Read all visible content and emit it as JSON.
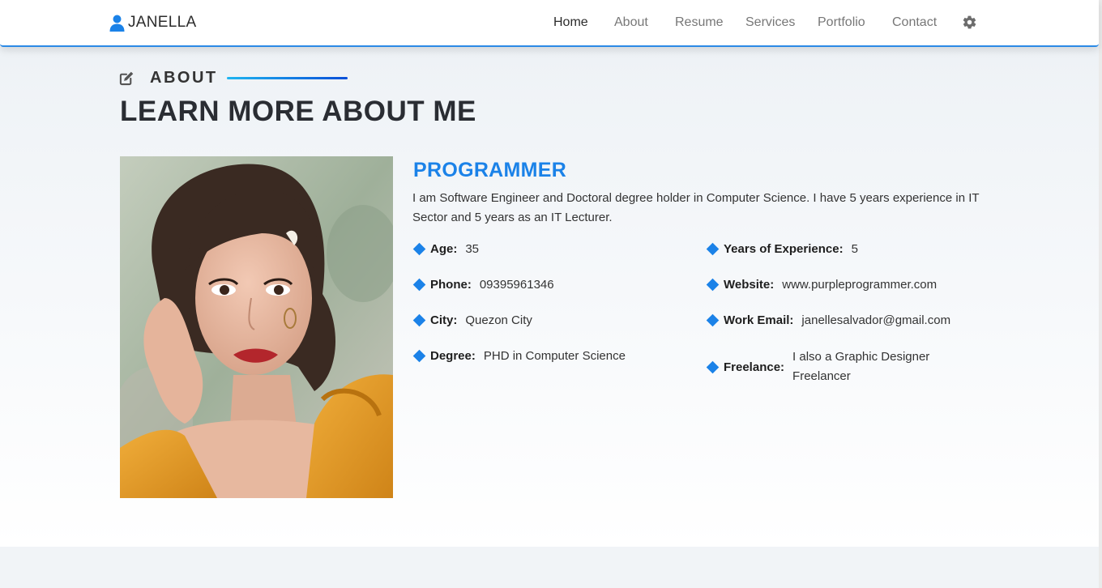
{
  "nav": {
    "brand": "JANELLA",
    "brand_icon": "user-icon",
    "links": [
      "Home",
      "About",
      "Resume",
      "Services",
      "Portfolio",
      "Contact"
    ],
    "active": "Home",
    "settings_icon": "gear-icon"
  },
  "about": {
    "eyebrow": "ABOUT",
    "eyebrow_icon": "edit-icon",
    "heading": "LEARN MORE ABOUT ME",
    "role": "PROGRAMMER",
    "bio": "I am Software Engineer and Doctoral degree holder in Computer Science. I have 5 years experience in IT Sector and 5 years as an IT Lecturer.",
    "left_items": [
      {
        "label": "Age:",
        "value": "35"
      },
      {
        "label": "Phone:",
        "value": "09395961346"
      },
      {
        "label": "City:",
        "value": "Quezon City"
      },
      {
        "label": "Degree:",
        "value": "PHD in Computer Science"
      }
    ],
    "right_items": [
      {
        "label": "Years of Experience:",
        "value": "5"
      },
      {
        "label": "Website:",
        "value": "www.purpleprogrammer.com"
      },
      {
        "label": "Work Email:",
        "value": "janellesalvador@gmail.com"
      },
      {
        "label": "Freelance:",
        "value": "I also a Graphic Designer Freelancer"
      }
    ]
  },
  "colors": {
    "accent": "#1b82e8",
    "nav_border": "#2b8ae6",
    "heading": "#2a2d33"
  }
}
